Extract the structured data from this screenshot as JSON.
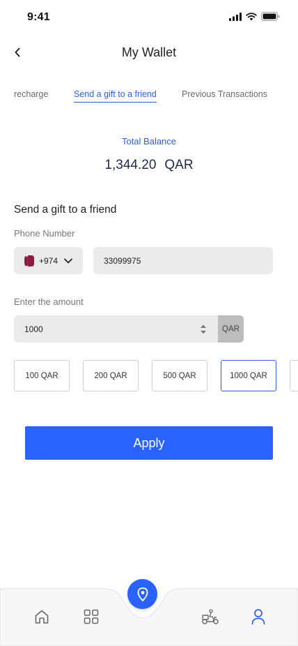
{
  "status_bar": {
    "time": "9:41"
  },
  "header": {
    "title": "My Wallet"
  },
  "tabs": [
    {
      "label": "recharge",
      "active": false
    },
    {
      "label": "Send a gift to a friend",
      "active": true
    },
    {
      "label": "Previous Transactions",
      "active": false
    }
  ],
  "balance": {
    "label": "Total Balance",
    "amount": "1,344.20",
    "currency": "QAR"
  },
  "form": {
    "title": "Send a gift to a friend",
    "phone_label": "Phone Number",
    "country_code": "+974",
    "country_flag": "qatar-flag-icon",
    "phone_value": "33099975",
    "amount_label": "Enter the amount",
    "amount_value": "1000",
    "amount_currency": "QAR"
  },
  "presets": [
    {
      "label": "100 QAR",
      "selected": false
    },
    {
      "label": "200 QAR",
      "selected": false
    },
    {
      "label": "500 QAR",
      "selected": false
    },
    {
      "label": "1000 QAR",
      "selected": true
    },
    {
      "label": "",
      "selected": false
    }
  ],
  "apply_label": "Apply",
  "colors": {
    "accent": "#2962ff",
    "link": "#2f5fe0",
    "field_bg": "#ebebeb",
    "flag": "#8d1b3d"
  },
  "bottom_nav": [
    "home-icon",
    "grid-icon",
    "location-pin-icon",
    "delivery-scooter-icon",
    "profile-icon"
  ]
}
